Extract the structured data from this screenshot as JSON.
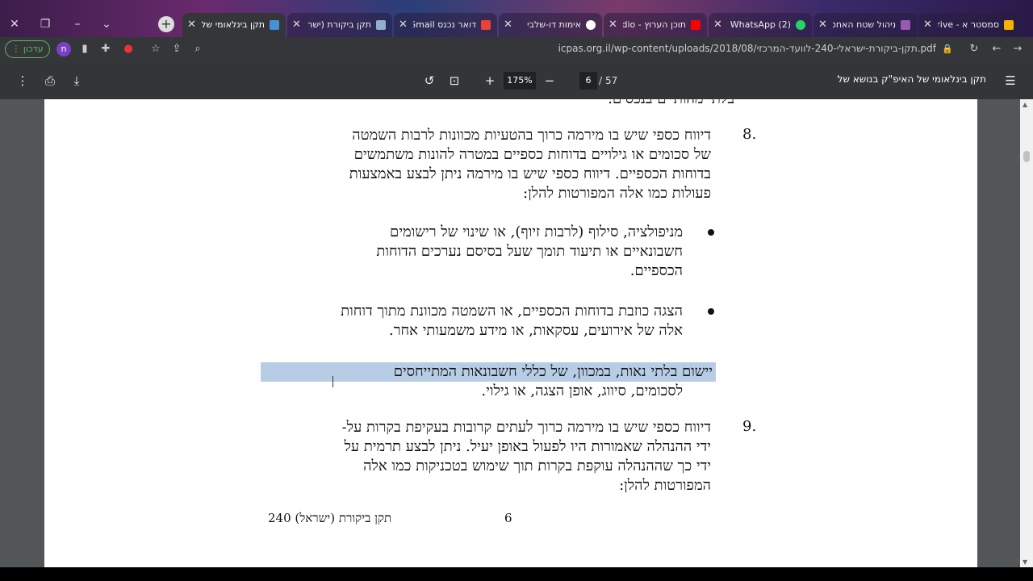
{
  "browser": {
    "tabs": [
      {
        "title": "תקן בינלאומי של",
        "active": true
      },
      {
        "title": "תקן ביקורת (ישר",
        "active": false
      },
      {
        "title": "דואר נכנס Gmail",
        "active": false
      },
      {
        "title": "אימות דו-שלבי",
        "active": false
      },
      {
        "title": "תוכן הערוץ - dio",
        "active": false
      },
      {
        "title": "(2) WhatsApp",
        "active": false
      },
      {
        "title": "ניהול שטח האחס",
        "active": false
      },
      {
        "title": "סמסטר א - Drive",
        "active": false
      }
    ],
    "update_label": "עדכון",
    "profile_initial": "n",
    "url": "icpas.org.il/wp-content/uploads/2018/08/תקן-ביקורת-ישראלי-240-לוועד-המרכזי.pdf"
  },
  "pdf_toolbar": {
    "zoom": "175%",
    "current_page": "6",
    "page_sep": "/",
    "total_pages": "57",
    "title": "תקן בינלאומי של האיפ\"ק בנושא של"
  },
  "document": {
    "top_fragment": "בלתי מהותיים בנכסים.",
    "item8_num": "8.",
    "item8_lines": [
      "דיווח כספי שיש בו מירמה כרוך בהטעיות מכוונות לרבות השמטה",
      "של סכומים או גילויים בדוחות כספיים במטרה להונות משתמשים",
      "בדוחות הכספיים. דיווח כספי שיש בו מירמה ניתן לבצע באמצעות",
      "פעולות כמו אלה המפורטות להלן:"
    ],
    "bullet1_lines": [
      "מניפולציה, סילוף (לרבות זיוף), או שינוי של רישומים",
      "חשבונאיים או תיעוד תומך שעל בסיסם נערכים הדוחות",
      "הכספיים."
    ],
    "bullet2_lines": [
      "הצגה כוזבת בדוחות הכספיים, או השמטה מכוונת מתוך דוחות",
      "אלה של אירועים, עסקאות, או מידע משמעותי אחר."
    ],
    "bullet3_line1": "יישום בלתי נאות, במכוון, של כללי חשבונאות המתייחסים",
    "bullet3_line2": "לסכומים, סיווג, אופן הצגה, או גילוי.",
    "item9_num": "9.",
    "item9_lines": [
      "דיווח כספי שיש בו מירמה כרוך לעתים קרובות בעקיפת בקרות על-",
      "ידי ההנהלה שאמורות היו לפעול באופן יעיל. ניתן לבצע תרמית על",
      "ידי כך שההנהלה עוקפת בקרות תוך שימוש בטכניקות כמו אלה",
      "המפורטות להלן:"
    ],
    "footer_page": "6",
    "footer_title": "תקן ביקורת (ישראל) 240"
  }
}
